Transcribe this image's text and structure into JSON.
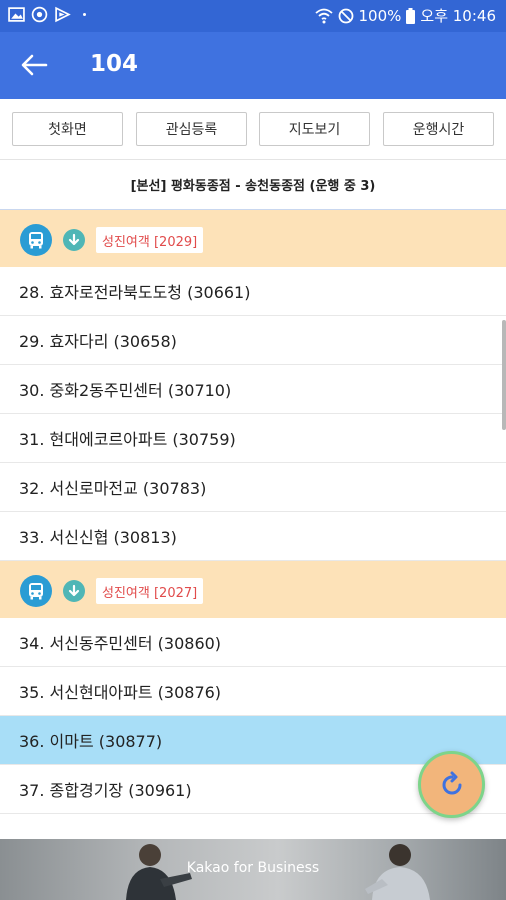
{
  "status_bar": {
    "battery": "100%",
    "time": "오후 10:46",
    "icons": [
      "image-icon",
      "circle-logo-icon",
      "play-flag-icon",
      "wifi-icon",
      "dnd-icon",
      "battery-icon"
    ]
  },
  "header": {
    "title": "104",
    "back_icon": "arrow-left-icon"
  },
  "toolbar": {
    "buttons": [
      "첫화면",
      "관심등록",
      "지도보기",
      "운행시간"
    ]
  },
  "route_info": "[본선] 평화동종점 - 송천동종점 (운행 중 3)",
  "stops": [
    {
      "kind": "bus",
      "plate": "성진여객 [2029]"
    },
    {
      "kind": "stop",
      "label": "28. 효자로전라북도도청 (30661)"
    },
    {
      "kind": "stop",
      "label": "29. 효자다리 (30658)"
    },
    {
      "kind": "stop",
      "label": "30. 중화2동주민센터 (30710)"
    },
    {
      "kind": "stop",
      "label": "31. 현대에코르아파트 (30759)"
    },
    {
      "kind": "stop",
      "label": "32. 서신로마전교 (30783)"
    },
    {
      "kind": "stop",
      "label": "33. 서신신협 (30813)"
    },
    {
      "kind": "bus",
      "plate": "성진여객 [2027]"
    },
    {
      "kind": "stop",
      "label": "34. 서신동주민센터 (30860)"
    },
    {
      "kind": "stop",
      "label": "35. 서신현대아파트 (30876)"
    },
    {
      "kind": "stop",
      "label": "36. 이마트 (30877)",
      "selected": true
    },
    {
      "kind": "stop",
      "label": "37. 종합경기장 (30961)"
    }
  ],
  "fab": {
    "icon": "refresh-icon"
  },
  "ad": {
    "text": "Kakao for Business"
  },
  "colors": {
    "status_bar": "#3366d4",
    "app_bar": "#3f72e0",
    "bus_row": "#fde2b8",
    "selected_row": "#a8def7",
    "plate_text": "#e14b4b",
    "bus_icon": "#2a9cd4",
    "fab": "#f2b57b"
  }
}
